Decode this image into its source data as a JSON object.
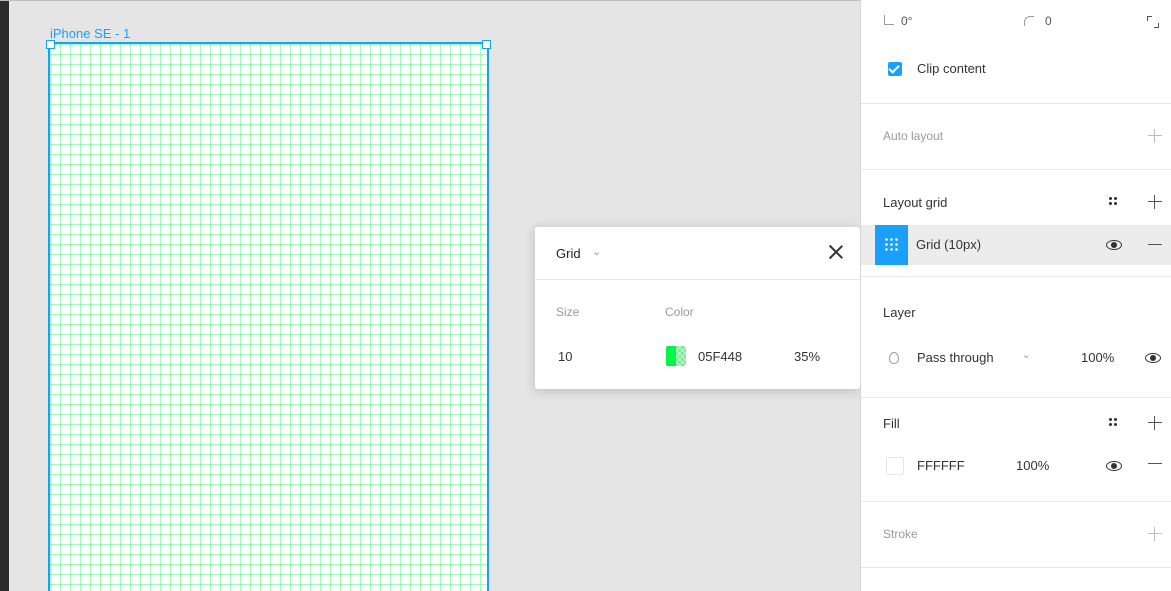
{
  "canvas": {
    "frame_label": "iPhone SE - 1",
    "grid_color": "#05F448",
    "accent": "#18A0FB"
  },
  "grid_popover": {
    "title": "Grid",
    "size_label": "Size",
    "color_label": "Color",
    "size_value": "10",
    "color_hex": "05F448",
    "opacity": "35%",
    "color_swatch": "#05F448"
  },
  "panel": {
    "rotation": "0°",
    "corner_radius": "0",
    "clip_content_label": "Clip content",
    "clip_content_checked": true,
    "auto_layout": {
      "title": "Auto layout"
    },
    "layout_grid": {
      "title": "Layout grid",
      "item_label": "Grid (10px)"
    },
    "layer": {
      "title": "Layer",
      "blend_mode": "Pass through",
      "opacity": "100%"
    },
    "fill": {
      "title": "Fill",
      "hex": "FFFFFF",
      "opacity": "100%"
    },
    "stroke": {
      "title": "Stroke"
    }
  }
}
